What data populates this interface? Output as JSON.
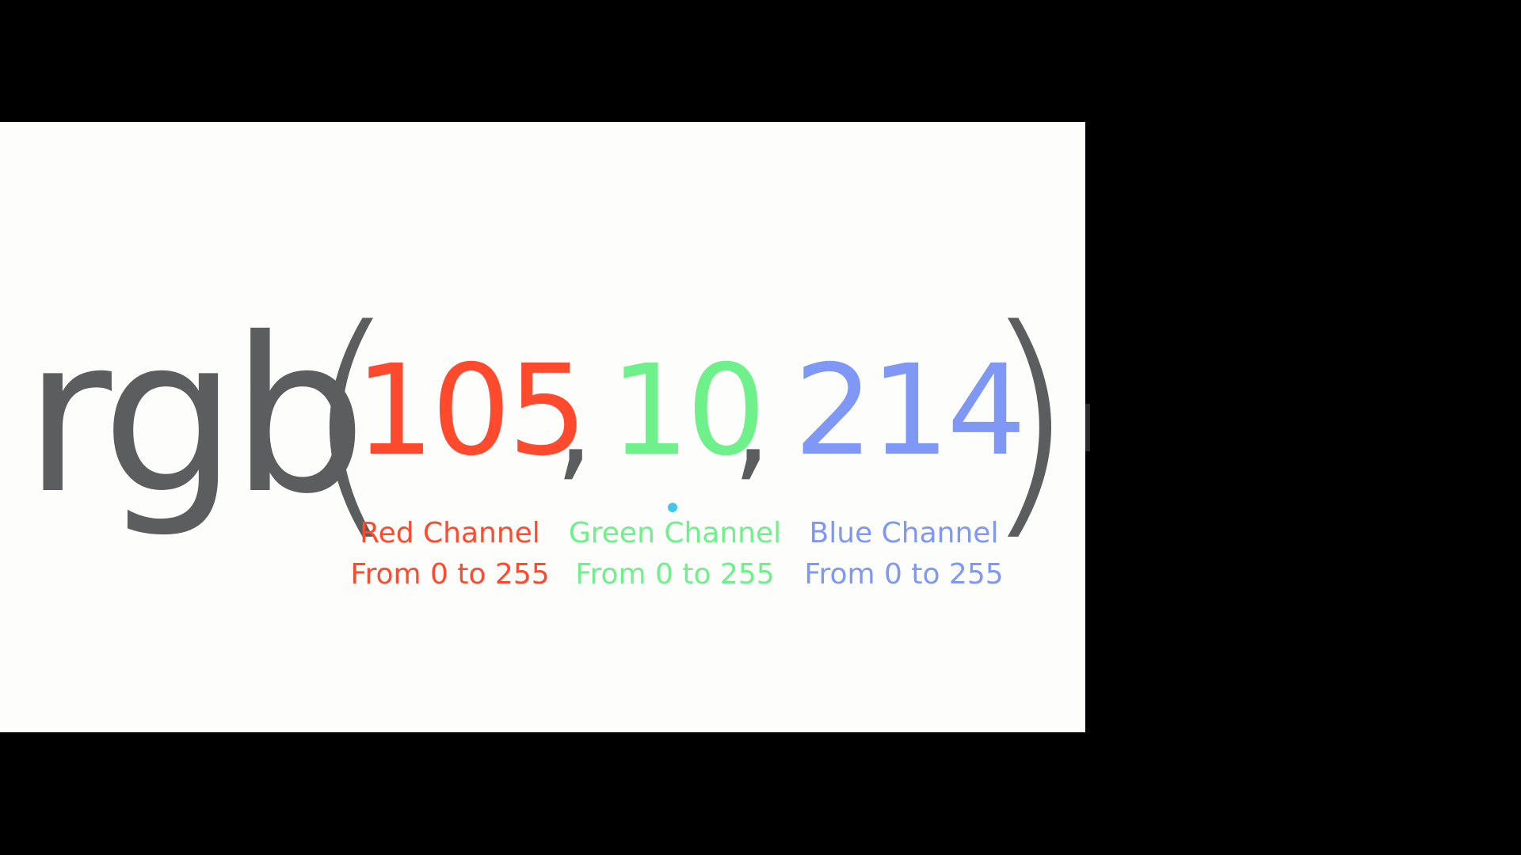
{
  "slide": {
    "function_word": "rgb",
    "open_paren": "(",
    "close_paren": ")",
    "comma": ",",
    "channels": [
      {
        "value": "105",
        "label": "Red Channel",
        "range": "From 0 to 255",
        "color": "#ff4a2e"
      },
      {
        "value": "10",
        "label": "Green Channel",
        "range": "From 0 to 255",
        "color": "#6ef08a"
      },
      {
        "value": "214",
        "label": "Blue Channel",
        "range": "From 0 to 255",
        "color": "#7f98f5"
      }
    ],
    "text_color": "#5c5d5e",
    "background_color": "#fdfdfb"
  },
  "cursor": {
    "icon": "pointer-dot-icon"
  }
}
